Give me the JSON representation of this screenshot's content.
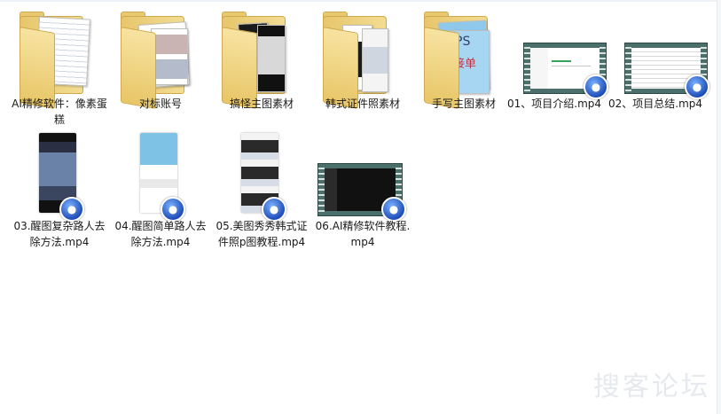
{
  "files": [
    {
      "name": "AI精修软件：像素蛋糕",
      "type": "folder",
      "icon": "folder-icon"
    },
    {
      "name": "对标账号",
      "type": "folder",
      "icon": "folder-icon"
    },
    {
      "name": "搞怪主图素材",
      "type": "folder",
      "icon": "folder-icon"
    },
    {
      "name": "韩式证件照素材",
      "type": "folder",
      "icon": "folder-icon"
    },
    {
      "name": "手写主图素材",
      "type": "folder",
      "icon": "folder-icon"
    },
    {
      "name": "01、项目介绍.mp4",
      "type": "video",
      "icon": "video-thumbnail-icon"
    },
    {
      "name": "02、项目总结.mp4",
      "type": "video",
      "icon": "video-thumbnail-icon"
    },
    {
      "name": "03.醒图复杂路人去除方法.mp4",
      "type": "video",
      "icon": "video-thumbnail-icon"
    },
    {
      "name": "04.醒图简单路人去除方法.mp4",
      "type": "video",
      "icon": "video-thumbnail-icon"
    },
    {
      "name": "05.美图秀秀韩式证件照p图教程.mp4",
      "type": "video",
      "icon": "video-thumbnail-icon"
    },
    {
      "name": "06.AI精修软件教程.mp4",
      "type": "video",
      "icon": "video-thumbnail-icon"
    }
  ],
  "thumb_text": {
    "ps": "PS",
    "handwrite": "接单"
  },
  "watermark": "搜客论坛",
  "colors": {
    "folder": "#f0d27f",
    "video_frame": "#4b6f6b",
    "play_badge": "#1f4db8"
  }
}
